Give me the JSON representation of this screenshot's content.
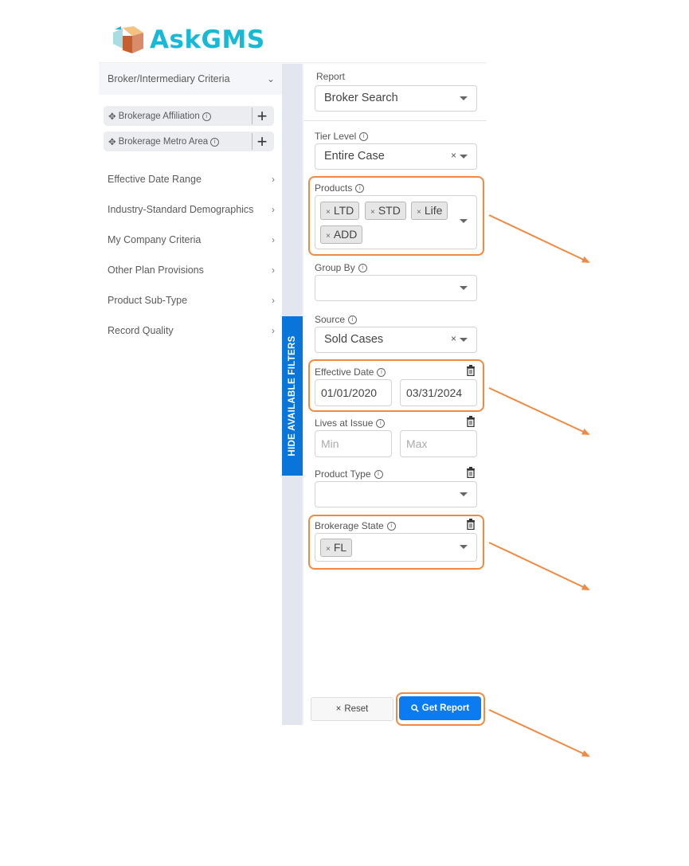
{
  "app": {
    "logo_text": "AskGMS",
    "brand_color": "#18b9d6",
    "accent_color": "#0b7bf2",
    "annotation_color": "#f08a42"
  },
  "sidebar": {
    "section_header": "Broker/Intermediary Criteria",
    "section_icon": "chevron-down-icon",
    "criteria": [
      {
        "label": "Brokerage Affiliation",
        "icon": "move-icon",
        "action_icon": "plus-icon"
      },
      {
        "label": "Brokerage Metro Area",
        "icon": "move-icon",
        "action_icon": "plus-icon"
      }
    ],
    "nav_items": [
      {
        "label": "Effective Date Range",
        "icon": "chevron-right-icon"
      },
      {
        "label": "Industry-Standard Demographics",
        "icon": "chevron-right-icon"
      },
      {
        "label": "My Company Criteria",
        "icon": "chevron-right-icon"
      },
      {
        "label": "Other Plan Provisions",
        "icon": "chevron-right-icon"
      },
      {
        "label": "Product Sub-Type",
        "icon": "chevron-right-icon"
      },
      {
        "label": "Record Quality",
        "icon": "chevron-right-icon"
      }
    ]
  },
  "toggle": {
    "label": "HIDE AVAILABLE FILTERS"
  },
  "form": {
    "report": {
      "label": "Report",
      "value": "Broker Search"
    },
    "tier_level": {
      "label": "Tier Level",
      "value": "Entire Case",
      "clear": "×"
    },
    "products": {
      "label": "Products",
      "tags": [
        "LTD",
        "STD",
        "Life",
        "ADD"
      ],
      "tag_remove": "×"
    },
    "group_by": {
      "label": "Group By",
      "value": ""
    },
    "source": {
      "label": "Source",
      "value": "Sold Cases",
      "clear": "×"
    },
    "effective_date": {
      "label": "Effective Date",
      "from": "01/01/2020",
      "to": "03/31/2024"
    },
    "lives_at_issue": {
      "label": "Lives at Issue",
      "min_placeholder": "Min",
      "max_placeholder": "Max"
    },
    "product_type": {
      "label": "Product Type",
      "value": ""
    },
    "brokerage_state": {
      "label": "Brokerage State",
      "tags": [
        "FL"
      ],
      "tag_remove": "×"
    }
  },
  "actions": {
    "reset_label": "Reset",
    "reset_icon": "×",
    "get_report_label": "Get Report"
  }
}
